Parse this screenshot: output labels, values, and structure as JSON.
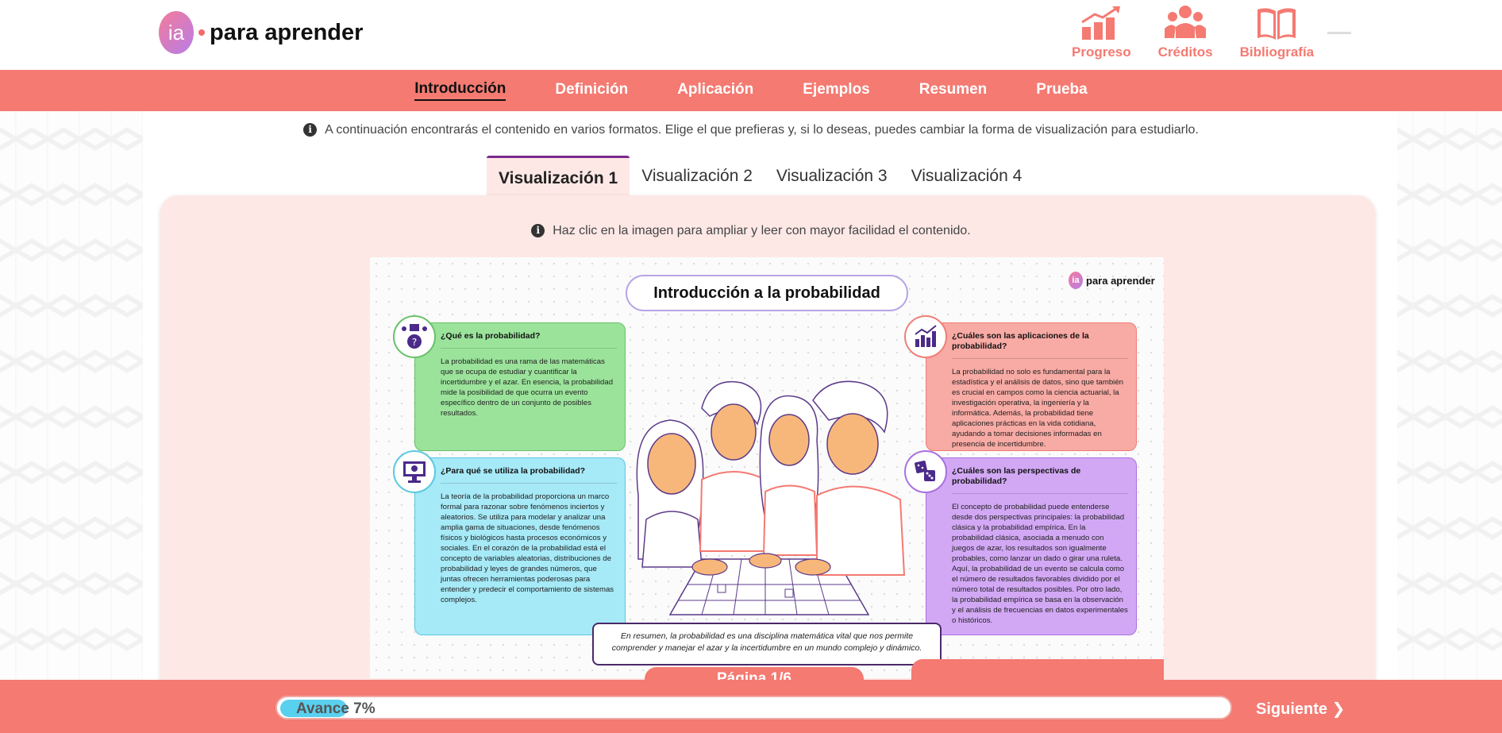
{
  "header": {
    "logo_badge": "ia",
    "logo_text": "para aprender",
    "icons": [
      {
        "label": "Progreso",
        "icon": "chart-up-icon"
      },
      {
        "label": "Créditos",
        "icon": "people-icon"
      },
      {
        "label": "Bibliografía",
        "icon": "book-icon"
      }
    ]
  },
  "nav": {
    "items": [
      "Introducción",
      "Definición",
      "Aplicación",
      "Ejemplos",
      "Resumen",
      "Prueba"
    ],
    "active": 0
  },
  "info_text": "A continuación encontrarás el contenido en varios formatos. Elige el que prefieras y, si lo deseas, puedes cambiar la forma de visualización para estudiarlo.",
  "tabs": [
    "Visualización 1",
    "Visualización 2",
    "Visualización 3",
    "Visualización 4"
  ],
  "panel_info": "Haz clic en la imagen para ampliar y leer con mayor facilidad el contenido.",
  "infographic": {
    "title": "Introducción a la probabilidad",
    "logo_badge": "ia",
    "logo_text": "para aprender",
    "cards": {
      "what": {
        "question": "¿Qué es la probabilidad?",
        "text": "La probabilidad es una rama de las matemáticas que se ocupa de estudiar y cuantificar la incertidumbre y el azar. En esencia, la probabilidad mide la posibilidad de que ocurra un evento específico dentro de un conjunto de posibles resultados."
      },
      "use": {
        "question": "¿Para qué se utiliza la probabilidad?",
        "text": "La teoría de la probabilidad proporciona un marco formal para razonar sobre fenómenos inciertos y aleatorios. Se utiliza para modelar y analizar una amplia gama de situaciones, desde fenómenos físicos y biológicos hasta procesos económicos y sociales. En el corazón de la probabilidad está el concepto de variables aleatorias, distribuciones de probabilidad y leyes de grandes números, que juntas ofrecen herramientas poderosas para entender y predecir el comportamiento de sistemas complejos."
      },
      "apps": {
        "question": "¿Cuáles son las aplicaciones de la probabilidad?",
        "text": "La probabilidad no solo es fundamental para la estadística y el análisis de datos, sino que también es crucial en campos como la ciencia actuarial, la investigación operativa, la ingeniería y la informática. Además, la probabilidad tiene aplicaciones prácticas en la vida cotidiana, ayudando a tomar decisiones informadas en presencia de incertidumbre."
      },
      "perspectives": {
        "question": "¿Cuáles son las perspectivas de probabilidad?",
        "text": "El concepto de probabilidad puede entenderse desde dos perspectivas principales: la probabilidad clásica y la probabilidad empírica. En la probabilidad clásica, asociada a menudo con juegos de azar, los resultados son igualmente probables, como lanzar un dado o girar una ruleta. Aquí, la probabilidad de un evento se calcula como el número de resultados favorables dividido por el número total de resultados posibles. Por otro lado, la probabilidad empírica se basa en la observación y el análisis de frecuencias en datos experimentales o históricos."
      }
    },
    "summary": "En resumen, la probabilidad es una disciplina matemática vital que nos permite comprender y manejar el azar y la incertidumbre en un mundo complejo y dinámico."
  },
  "page_label": "Página 1/6",
  "progress": {
    "label": "Avance 7%",
    "percent": 7
  },
  "next_label": "Siguiente ❯"
}
